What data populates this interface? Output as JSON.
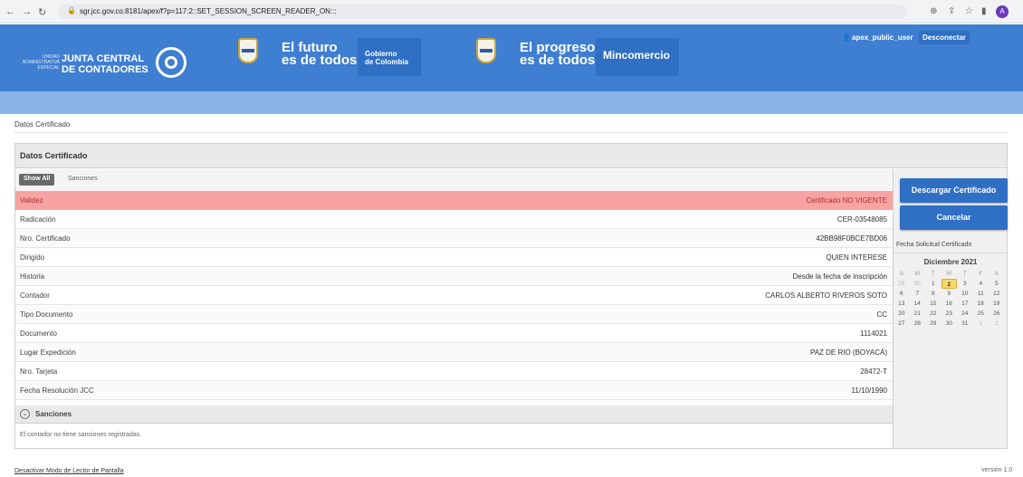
{
  "browser": {
    "url": "sgr.jcc.gov.co:8181/apex/f?p=117:2::SET_SESSION_SCREEN_READER_ON:::",
    "avatar_letter": "A"
  },
  "header": {
    "org_small": "UNIDAD ADMINISTRATIVA ESPECIAL",
    "org_line1": "JUNTA CENTRAL",
    "org_line2": "DE CONTADORES",
    "slogan1_line1": "El futuro",
    "slogan1_line2": "es de todos",
    "gov_line1": "Gobierno",
    "gov_line2": "de Colombia",
    "slogan2_line1": "El progreso",
    "slogan2_line2": "es de todos",
    "mincomercio": "Mincomercio",
    "user": "apex_public_user",
    "logout": "Desconectar"
  },
  "breadcrumb": "Datos Certificado",
  "panel": {
    "title": "Datos Certificado",
    "tabs": {
      "active": "Show All",
      "other": "Sanciones"
    },
    "rows": [
      {
        "label": "Validez",
        "value": "Certificado NO VIGENTE"
      },
      {
        "label": "Radicación",
        "value": "CER-03548085"
      },
      {
        "label": "Nro. Certificado",
        "value": "42BB98F0BCE7BD06"
      },
      {
        "label": "Dirigido",
        "value": "QUIEN INTERESE"
      },
      {
        "label": "Historia",
        "value": "Desde la fecha de inscripción"
      },
      {
        "label": "Contador",
        "value": "CARLOS ALBERTO RIVEROS SOTO"
      },
      {
        "label": "Tipo Documento",
        "value": "CC"
      },
      {
        "label": "Documento",
        "value": "1114021"
      },
      {
        "label": "Lugar Expedición",
        "value": "PAZ DE RIO (BOYACÁ)"
      },
      {
        "label": "Nro. Tarjeta",
        "value": "28472-T"
      },
      {
        "label": "Fecha Resolución JCC",
        "value": "11/10/1990"
      }
    ],
    "sanctions_title": "Sanciones",
    "sanctions_text": "El contador no tiene sanciones registradas."
  },
  "sidebar": {
    "download_button": "Descargar Certificado",
    "cancel_button": "Cancelar",
    "date_label": "Fecha Solicitud Certificado",
    "calendar": {
      "month": "Diciembre 2021",
      "weekdays": [
        "S",
        "M",
        "T",
        "W",
        "T",
        "F",
        "S"
      ],
      "weeks": [
        [
          "29",
          "30",
          "1",
          "2",
          "3",
          "4",
          "5"
        ],
        [
          "6",
          "7",
          "8",
          "9",
          "10",
          "11",
          "12"
        ],
        [
          "13",
          "14",
          "15",
          "16",
          "17",
          "18",
          "19"
        ],
        [
          "20",
          "21",
          "22",
          "23",
          "24",
          "25",
          "26"
        ],
        [
          "27",
          "28",
          "29",
          "30",
          "31",
          "1",
          "2"
        ]
      ],
      "selected": "2"
    }
  },
  "footer": {
    "link": "Desactivar Modo de Lector de Pantalla",
    "version": "versión 1.0"
  },
  "colors": {
    "header_blue": "#3f7fd2",
    "button_blue": "#2f6fc4",
    "alert_pink": "#f7a3a3",
    "alert_text": "#b02f2f"
  }
}
